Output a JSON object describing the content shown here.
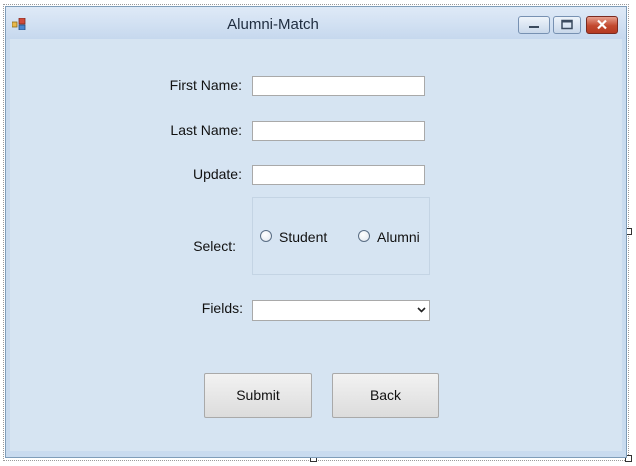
{
  "window": {
    "title": "Alumni-Match"
  },
  "form": {
    "first_name_label": "First Name:",
    "first_name_value": "",
    "last_name_label": "Last Name:",
    "last_name_value": "",
    "update_label": "Update:",
    "update_value": "",
    "select_label": "Select:",
    "radio_student": "Student",
    "radio_alumni": "Alumni",
    "fields_label": "Fields:",
    "fields_value": ""
  },
  "buttons": {
    "submit": "Submit",
    "back": "Back"
  },
  "icons": {
    "app": "app-icon",
    "minimize": "minimize-icon",
    "maximize": "maximize-icon",
    "close": "close-icon",
    "dropdown": "chevron-down-icon"
  }
}
